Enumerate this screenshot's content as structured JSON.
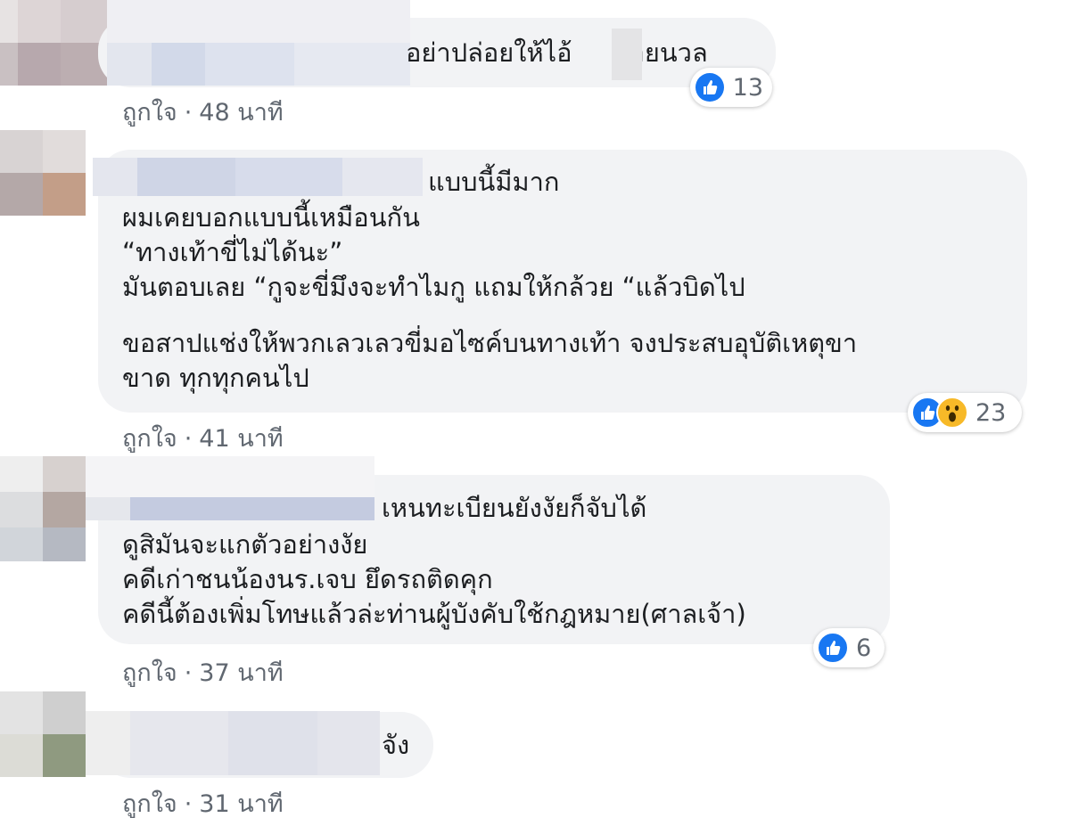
{
  "comments": [
    {
      "text": "อย่าปล่อยให้ไอ้     ลอยนวล",
      "like_label": "ถูกใจ",
      "time": "48 นาที",
      "reaction_count": "13"
    },
    {
      "lines": [
        "แบบนี้มีมาก",
        "ผมเคยบอกแบบนี้เหมือนกัน",
        "“ทางเท้าขี่ไม่ได้นะ”",
        "มันตอบเลย “กูจะขี่มึงจะทำไมกู แถมให้กล้วย “แล้วบิดไป",
        "ขอสาปแช่งให้พวกเลวเลวขี่มอไซค์บนทางเท้า จงประสบอุบัติเหตุขา",
        "ขาด ทุกทุกคนไป"
      ],
      "like_label": "ถูกใจ",
      "time": "41 นาที",
      "reaction_count": "23"
    },
    {
      "lines": [
        "เหนทะเบียนยังงัยก็จับได้",
        "ดูสิมันจะแกตัวอย่างงัย",
        "คดีเก่าชนน้องนร.เจบ ยึดรถติดคุก",
        "คดีนี้ต้องเพิ่มโทษแล้วล่ะท่านผู้บังคับใช้กฎหมาย(ศาลเจ้า)"
      ],
      "like_label": "ถูกใจ",
      "time": "37 นาที",
      "reaction_count": "6"
    },
    {
      "text": "จัง",
      "like_label": "ถูกใจ",
      "time": "31 นาที"
    }
  ],
  "meta_separator": "·",
  "colors": {
    "bubble": "#f2f3f5",
    "like_blue": "#1877f2",
    "wow_yellow": "#f7b928",
    "meta_gray": "#606770"
  },
  "icons": [
    "like-icon",
    "wow-icon"
  ]
}
